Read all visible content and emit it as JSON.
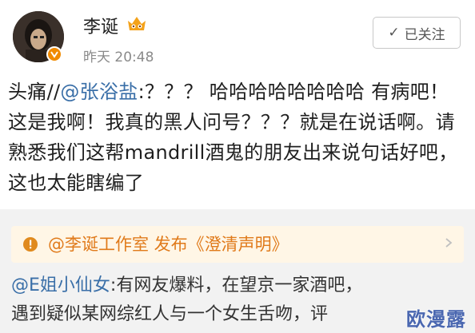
{
  "post": {
    "username": "李诞",
    "time": "昨天 20:48",
    "follow_label": "已关注",
    "content_prefix": "头痛//",
    "content_mention": "@张浴盐",
    "content_body": ":？？？ 哈哈哈哈哈哈哈哈 有病吧！这是我啊！我真的黑人问号？？？就是在说话啊。请熟悉我们这帮mandrill酒鬼的朋友出来说句话好吧，这也太能瞎编了"
  },
  "repost": {
    "notice_text": "@李诞工作室 发布《澄清声明》",
    "author": "@E姐小仙女",
    "text_line1": ":有网友爆料，在望京一家酒吧，",
    "text_line2": "遇到疑似某网综红人与一个女生舌吻，评"
  },
  "watermark": "欧漫露",
  "colors": {
    "link": "#3a6fa8",
    "notice_text": "#e07a1a",
    "notice_bg": "#fff6e6",
    "verified_badge": "#f08a00"
  }
}
